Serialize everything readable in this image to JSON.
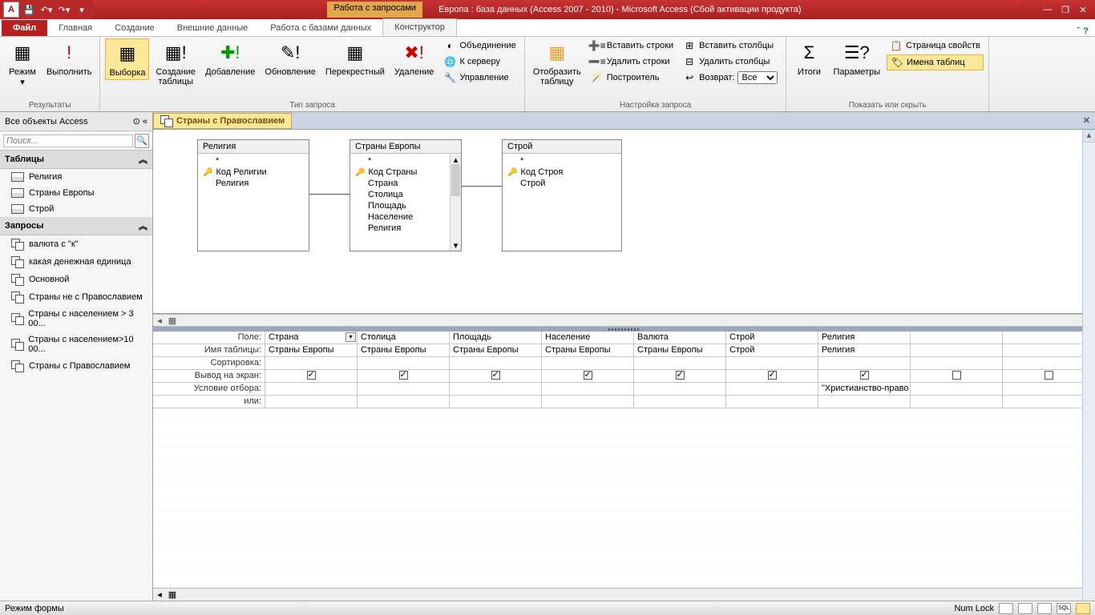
{
  "title": {
    "context": "Работа с запросами",
    "text": "Европа : база данных (Access 2007 - 2010)  -  Microsoft Access (Сбой активации продукта)"
  },
  "ribbonTabs": {
    "file": "Файл",
    "t1": "Главная",
    "t2": "Создание",
    "t3": "Внешние данные",
    "t4": "Работа с базами данных",
    "t5": "Конструктор"
  },
  "ribbon": {
    "g1": {
      "label": "Результаты",
      "b1": "Режим",
      "b2": "Выполнить"
    },
    "g2": {
      "label": "Тип запроса",
      "b1": "Выборка",
      "b2": "Создание\nтаблицы",
      "b3": "Добавление",
      "b4": "Обновление",
      "b5": "Перекрестный",
      "b6": "Удаление",
      "s1": "Объединение",
      "s2": "К серверу",
      "s3": "Управление"
    },
    "g3": {
      "label": "",
      "b1": "Отобразить\nтаблицу"
    },
    "g4": {
      "label": "Настройка запроса",
      "s1": "Вставить строки",
      "s2": "Удалить строки",
      "s3": "Построитель",
      "c1": "Вставить столбцы",
      "c2": "Удалить столбцы",
      "c3l": "Возврат:",
      "c3v": "Все"
    },
    "g5": {
      "label": "Показать или скрыть",
      "b1": "Итоги",
      "b2": "Параметры",
      "s1": "Страница свойств",
      "s2": "Имена таблиц"
    }
  },
  "nav": {
    "title": "Все объекты Access",
    "search": "Поиск...",
    "grp1": "Таблицы",
    "tables": [
      "Религия",
      "Страны Европы",
      "Строй"
    ],
    "grp2": "Запросы",
    "queries": [
      "валюта с \"к\"",
      "какая денежная единица",
      "Основной",
      "Страны не с Православием",
      "Страны с населением > 3 00...",
      "Страны с населением>10 00...",
      "Страны с Православием"
    ]
  },
  "doc": {
    "tab": "Страны с Православием"
  },
  "boxes": {
    "b1": {
      "title": "Религия",
      "rows": [
        "*",
        "Код Религии",
        "Религия"
      ],
      "key": 1
    },
    "b2": {
      "title": "Страны Европы",
      "rows": [
        "*",
        "Код Страны",
        "Страна",
        "Столица",
        "Площадь",
        "Население",
        "Религия"
      ],
      "key": 1
    },
    "b3": {
      "title": "Строй",
      "rows": [
        "*",
        "Код Строя",
        "Строй"
      ],
      "key": 1
    }
  },
  "grid": {
    "rows": {
      "r1": "Поле:",
      "r2": "Имя таблицы:",
      "r3": "Сортировка:",
      "r4": "Вывод на экран:",
      "r5": "Условие отбора:",
      "r6": "или:"
    },
    "cols": [
      {
        "field": "Страна",
        "table": "Страны Европы",
        "show": true,
        "crit": ""
      },
      {
        "field": "Столица",
        "table": "Страны Европы",
        "show": true,
        "crit": ""
      },
      {
        "field": "Площадь",
        "table": "Страны Европы",
        "show": true,
        "crit": ""
      },
      {
        "field": "Население",
        "table": "Страны Европы",
        "show": true,
        "crit": ""
      },
      {
        "field": "Валюта",
        "table": "Страны Европы",
        "show": true,
        "crit": ""
      },
      {
        "field": "Строй",
        "table": "Строй",
        "show": true,
        "crit": ""
      },
      {
        "field": "Религия",
        "table": "Религия",
        "show": true,
        "crit": "\"Христианство-право"
      },
      {
        "field": "",
        "table": "",
        "show": false,
        "crit": ""
      },
      {
        "field": "",
        "table": "",
        "show": false,
        "crit": ""
      }
    ]
  },
  "status": {
    "left": "Режим формы",
    "numlock": "Num Lock"
  }
}
